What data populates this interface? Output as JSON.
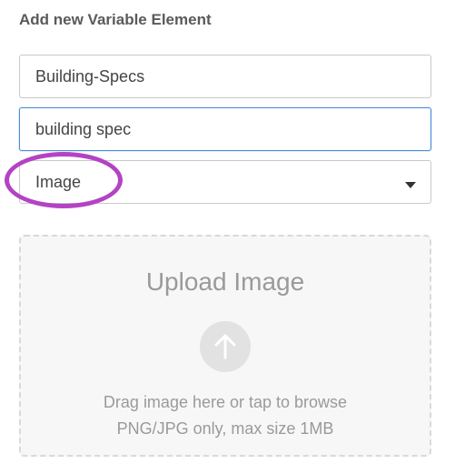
{
  "form": {
    "heading": "Add new Variable Element",
    "name_field": {
      "value": "Building-Specs"
    },
    "label_field": {
      "value": "building spec"
    },
    "type_select": {
      "selected": "Image"
    },
    "highlight_color": "#b443c4",
    "focus_color": "#4a8ad8"
  },
  "upload": {
    "title": "Upload Image",
    "icon": "arrow-up-icon",
    "hint": "Drag image here or tap to browse",
    "constraints": "PNG/JPG only, max size 1MB"
  }
}
